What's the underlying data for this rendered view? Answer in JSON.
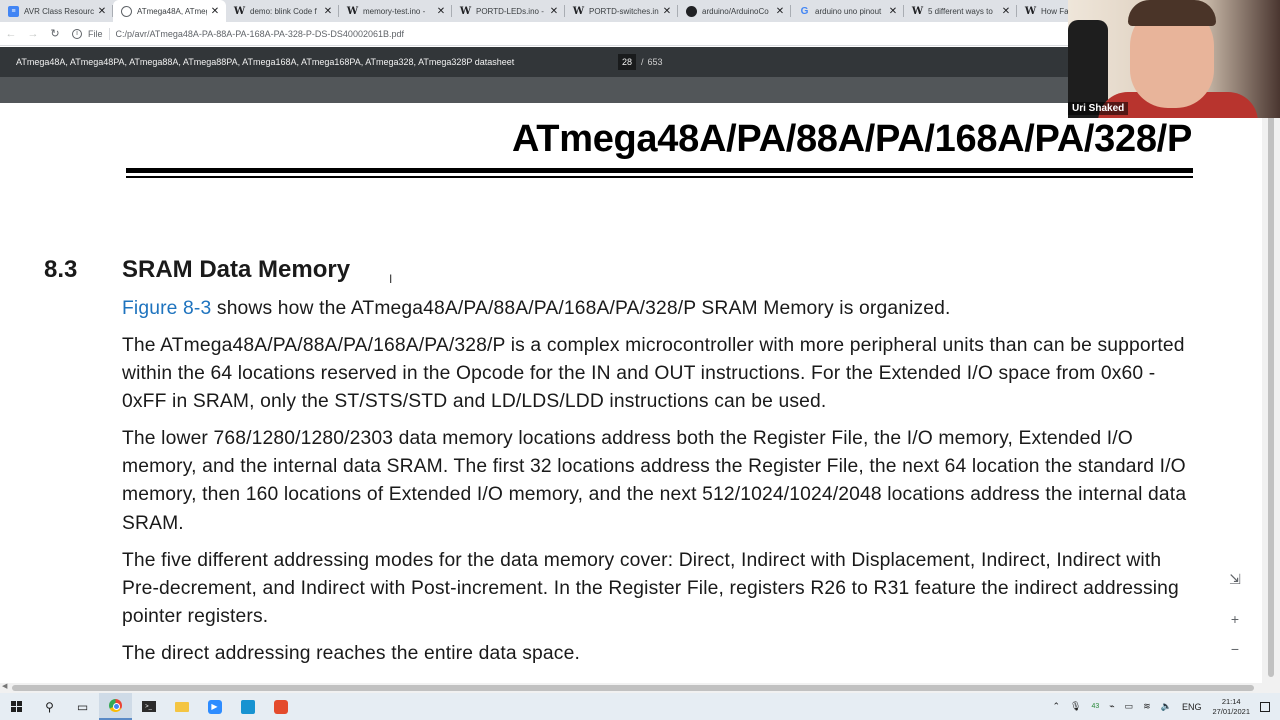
{
  "browser": {
    "tabs": [
      {
        "icon": "doc-icon",
        "title": "AVR Class Resource"
      },
      {
        "icon": "globe-icon",
        "title": "ATmega48A, ATmeg",
        "active": true
      },
      {
        "icon": "w-icon",
        "title": "demo: blink Code f"
      },
      {
        "icon": "w-icon",
        "title": "memory-test.ino -"
      },
      {
        "icon": "w-icon",
        "title": "PORTD-LEDs.ino -"
      },
      {
        "icon": "w-icon",
        "title": "PORTD-switches.ino"
      },
      {
        "icon": "github-icon",
        "title": "arduino/ArduinoCo"
      },
      {
        "icon": "google-icon",
        "title": "arduino uno pinout"
      },
      {
        "icon": "w-icon",
        "title": "5 different ways to"
      },
      {
        "icon": "w-icon",
        "title": "How Fa"
      }
    ],
    "address": {
      "scheme_label": "File",
      "url": "C:/p/avr/ATmega48A-PA-88A-PA-168A-PA-328-P-DS-DS40002061B.pdf"
    }
  },
  "pdf_viewer": {
    "title": "ATmega48A, ATmega48PA, ATmega88A, ATmega88PA, ATmega168A, ATmega168PA, ATmega328, ATmega328P datasheet",
    "page_current": "28",
    "page_separator": "/",
    "page_total": "653"
  },
  "document": {
    "header_title": "ATmega48A/PA/88A/PA/168A/PA/328/P",
    "section_number": "8.3",
    "section_title": "SRAM Data Memory",
    "p1_link": "Figure 8-3",
    "p1_rest": " shows how the ATmega48A/PA/88A/PA/168A/PA/328/P SRAM Memory is organized.",
    "p2": "The ATmega48A/PA/88A/PA/168A/PA/328/P is a complex microcontroller with more peripheral units than can be supported within the 64 locations reserved in the Opcode for the IN and OUT instructions. For the Extended I/O space from 0x60 - 0xFF in SRAM, only the ST/STS/STD and LD/LDS/LDD instructions can be used.",
    "p3": "The lower 768/1280/1280/2303 data memory locations address both the Register File, the I/O memory, Extended I/O memory, and the internal data SRAM. The first 32 locations address the Register File, the next 64 location the standard I/O memory, then 160 locations of Extended I/O memory, and the next 512/1024/1024/2048 locations address the internal data SRAM.",
    "p4": "The five different addressing modes for the data memory cover: Direct, Indirect with Displacement, Indirect, Indirect with Pre-decrement, and Indirect with Post-increment. In the Register File, registers R26 to R31 feature the indirect addressing pointer registers.",
    "p5": "The direct addressing reaches the entire data space."
  },
  "webcam": {
    "name": "Uri Shaked"
  },
  "taskbar": {
    "language": "ENG",
    "badge": "43",
    "time": "21:14",
    "date": "27/01/2021"
  },
  "colors": {
    "link": "#1e73be",
    "pdf_toolbar": "#323639",
    "tabstrip": "#dee1e6"
  }
}
